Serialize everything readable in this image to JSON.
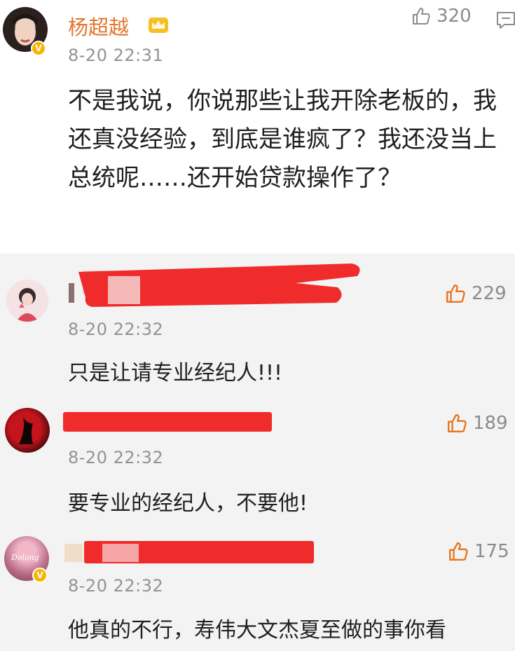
{
  "post": {
    "author_name": "杨超越",
    "timestamp": "8-20 22:31",
    "like_count": "320",
    "text": "不是我说，你说那些让我开除老板的，我还真没经验，到底是谁疯了？我还没当上总统呢……还开始贷款操作了？"
  },
  "comments": [
    {
      "timestamp": "8-20 22:32",
      "like_count": "229",
      "text": "只是让请专业经纪人!!!"
    },
    {
      "timestamp": "8-20 22:32",
      "like_count": "189",
      "text": "要专业的经纪人，不要他!"
    },
    {
      "timestamp": "8-20 22:32",
      "like_count": "175",
      "text": "他真的不行，寿伟大文杰夏至做的事你看",
      "avatar_text": "Dolong"
    }
  ],
  "badge_glyph": "V",
  "colors": {
    "author_orange": "#e2762b",
    "like_orange": "#e8741d",
    "redaction_red": "#ef2b2b",
    "timestamp_gray": "#939393"
  },
  "icons": [
    "thumbs-up-icon",
    "crown-icon",
    "comment-icon",
    "verified-badge-icon"
  ]
}
